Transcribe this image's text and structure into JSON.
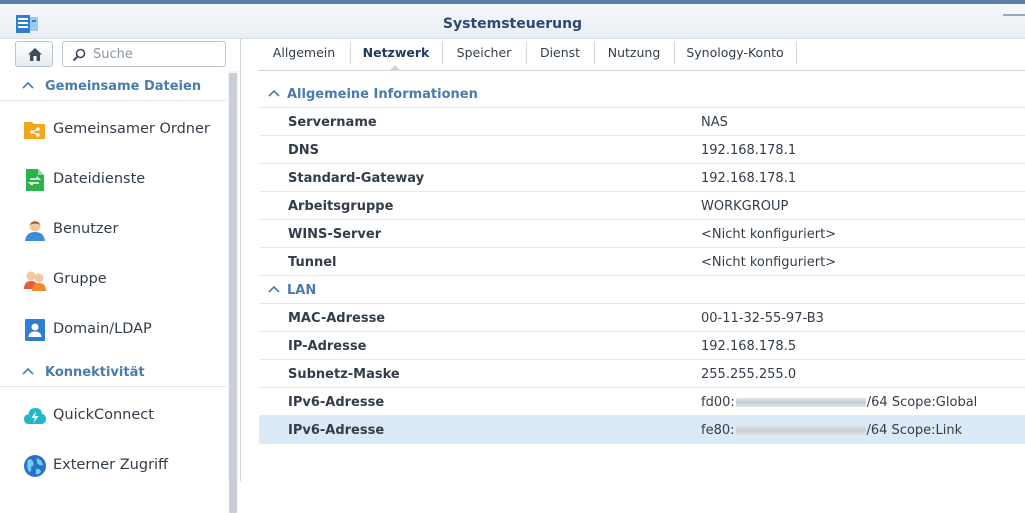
{
  "window": {
    "title": "Systemsteuerung"
  },
  "search": {
    "placeholder": "Suche"
  },
  "sidebar": {
    "sections": [
      {
        "label": "Gemeinsame Dateien",
        "items": [
          "Gemeinsamer Ordner",
          "Dateidienste",
          "Benutzer",
          "Gruppe",
          "Domain/LDAP"
        ]
      },
      {
        "label": "Konnektivität",
        "items": [
          "QuickConnect",
          "Externer Zugriff"
        ]
      }
    ]
  },
  "tabs": [
    "Allgemein",
    "Netzwerk",
    "Speicher",
    "Dienst",
    "Nutzung",
    "Synology-Konto"
  ],
  "active_tab": "Netzwerk",
  "sections": [
    {
      "title": "Allgemeine Informationen",
      "rows": [
        {
          "key": "Servername",
          "value": "NAS"
        },
        {
          "key": "DNS",
          "value": "192.168.178.1"
        },
        {
          "key": "Standard-Gateway",
          "value": "192.168.178.1"
        },
        {
          "key": "Arbeitsgruppe",
          "value": "WORKGROUP"
        },
        {
          "key": "WINS-Server",
          "value": "<Nicht konfiguriert>"
        },
        {
          "key": "Tunnel",
          "value": "<Nicht konfiguriert>"
        }
      ]
    },
    {
      "title": "LAN",
      "rows": [
        {
          "key": "MAC-Adresse",
          "value": "00-11-32-55-97-B3"
        },
        {
          "key": "IP-Adresse",
          "value": "192.168.178.5"
        },
        {
          "key": "Subnetz-Maske",
          "value": "255.255.255.0"
        },
        {
          "key": "IPv6-Adresse",
          "value_prefix": "fd00:",
          "value_suffix": "/64 Scope:Global"
        },
        {
          "key": "IPv6-Adresse",
          "value_prefix": "fe80:",
          "value_suffix": "/64 Scope:Link"
        }
      ]
    }
  ],
  "colors": {
    "accent": "#4a7bb0",
    "selected_row": "#dce9f7",
    "title": "#2b4a73"
  }
}
